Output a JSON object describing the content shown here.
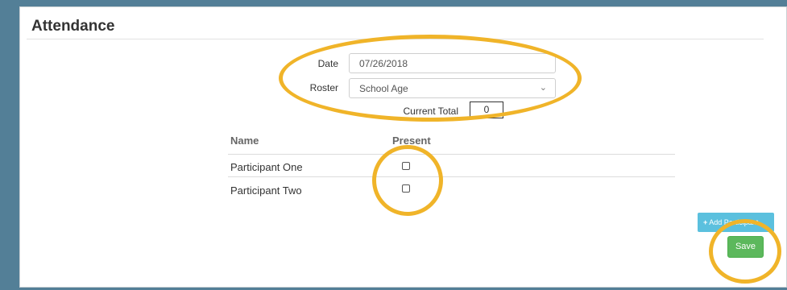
{
  "page": {
    "title": "Attendance"
  },
  "form": {
    "date_label": "Date",
    "date_value": "07/26/2018",
    "roster_label": "Roster",
    "roster_value": "School Age",
    "current_total_label": "Current Total",
    "current_total_value": "0"
  },
  "table": {
    "columns": [
      "Name",
      "Present"
    ],
    "rows": [
      {
        "name": "Participant One",
        "present": false
      },
      {
        "name": "Participant Two",
        "present": false
      }
    ]
  },
  "actions": {
    "add_participant_label": "Add Participant",
    "save_label": "Save"
  },
  "colors": {
    "background": "#537f97",
    "highlight": "#f0b429",
    "info_button": "#5bc0de",
    "success_button": "#5cb85c"
  },
  "icons": {
    "add": "plus-icon",
    "select": "chevron-down-icon"
  }
}
